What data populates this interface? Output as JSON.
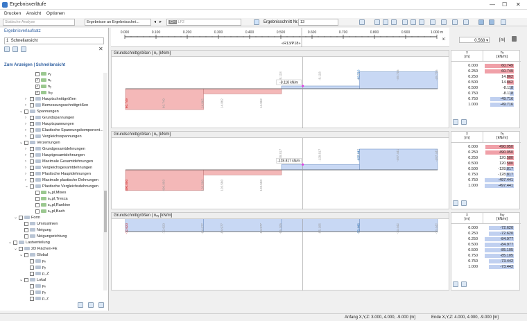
{
  "window": {
    "title": "Ergebnisverläufe"
  },
  "menu": [
    "Drucken",
    "Ansicht",
    "Optionen"
  ],
  "toolbar": {
    "analysis": "Statische Analyse",
    "results": "Ergebnisse an Ergebnisschni...",
    "load_prefix": "CH",
    "load_value": "LF2",
    "section_label": "Ergebnisschnitt Nr.",
    "section_value": "13"
  },
  "ruler": {
    "ticks": [
      "0.000",
      "0.100",
      "0.200",
      "0.300",
      "0.400",
      "0.500",
      "0.600",
      "0.700",
      "0.800",
      "0.900",
      "1.000 m"
    ],
    "unit": "x",
    "section": "«R13/P18»",
    "pos_value": "0.568",
    "pos_unit": "[m]",
    "pos_label": "x:"
  },
  "left": {
    "label": "Ergebnisverlaufsatz",
    "preset_num": "1",
    "preset_name": "Schnellansicht",
    "section": "Zum Anzeigen | Schnellansicht",
    "tree": [
      {
        "t": "vᵧ",
        "lvl": 3,
        "cb": "o"
      },
      {
        "t": "nₓ",
        "lvl": 3,
        "cb": "x"
      },
      {
        "t": "nᵧ",
        "lvl": 3,
        "cb": "x"
      },
      {
        "t": "nₓᵧ",
        "lvl": 3,
        "cb": "x"
      },
      {
        "t": "Hauptschnittgrößen",
        "lvl": 2,
        "cb": "o",
        "exp": "›"
      },
      {
        "t": "Bemessungsschnittgrößen",
        "lvl": 2,
        "cb": "o",
        "exp": "›"
      },
      {
        "t": "Spannungen",
        "lvl": 1,
        "cb": "o",
        "exp": "⌄"
      },
      {
        "t": "Grundspannungen",
        "lvl": 2,
        "cb": "o",
        "exp": "›"
      },
      {
        "t": "Hauptspannungen",
        "lvl": 2,
        "cb": "o",
        "exp": "›"
      },
      {
        "t": "Elastische Spannungskomponent...",
        "lvl": 2,
        "cb": "o",
        "exp": "›"
      },
      {
        "t": "Vergleichsspannungen",
        "lvl": 2,
        "cb": "o",
        "exp": "›"
      },
      {
        "t": "Verzerrungen",
        "lvl": 1,
        "cb": "o",
        "exp": "⌄"
      },
      {
        "t": "Grundgesamtdehnungen",
        "lvl": 2,
        "cb": "o",
        "exp": "›"
      },
      {
        "t": "Hauptgesamtdehnungen",
        "lvl": 2,
        "cb": "o",
        "exp": "›"
      },
      {
        "t": "Maximale Gesamtdehnungen",
        "lvl": 2,
        "cb": "o",
        "exp": "›"
      },
      {
        "t": "Vergleichsgesamtdehnungen",
        "lvl": 2,
        "cb": "o",
        "exp": "›"
      },
      {
        "t": "Plastische Hauptdehnungen",
        "lvl": 2,
        "cb": "o",
        "exp": "›"
      },
      {
        "t": "Maximale plastische Dehnungen",
        "lvl": 2,
        "cb": "o",
        "exp": "›"
      },
      {
        "t": "Plastische Vergleichsdehnungen",
        "lvl": 2,
        "cb": "o",
        "exp": "⌄"
      },
      {
        "t": "εᵥ,pl,Mises",
        "lvl": 3,
        "cb": "o"
      },
      {
        "t": "εᵥ,pl,Tresca",
        "lvl": 3,
        "cb": "o"
      },
      {
        "t": "εᵥ,pl,Rankine",
        "lvl": 3,
        "cb": "o"
      },
      {
        "t": "εᵥ,pl,Bach",
        "lvl": 3,
        "cb": "o"
      },
      {
        "t": "Form",
        "lvl": 0,
        "cb": "o",
        "exp": "⌄"
      },
      {
        "t": "Umrisslinien",
        "lvl": 1,
        "cb": "o"
      },
      {
        "t": "Neigung",
        "lvl": 1,
        "cb": "o"
      },
      {
        "t": "Neigungsrichtung",
        "lvl": 1,
        "cb": "o"
      },
      {
        "t": "Lastverteilung",
        "lvl": -1,
        "cb": "o",
        "exp": "⌄"
      },
      {
        "t": "2D Flächen-FE",
        "lvl": 0,
        "cb": "o",
        "exp": "⌄"
      },
      {
        "t": "Global",
        "lvl": 1,
        "cb": "o",
        "exp": "⌄"
      },
      {
        "t": "pₓ",
        "lvl": 2,
        "cb": "o"
      },
      {
        "t": "pᵧ",
        "lvl": 2,
        "cb": "o"
      },
      {
        "t": "p_Z",
        "lvl": 2,
        "cb": "o"
      },
      {
        "t": "Lokal",
        "lvl": 1,
        "cb": "o",
        "exp": "⌄"
      },
      {
        "t": "pₓ",
        "lvl": 2,
        "cb": "o"
      },
      {
        "t": "pᵧ",
        "lvl": 2,
        "cb": "o"
      },
      {
        "t": "p_z",
        "lvl": 2,
        "cb": "o"
      }
    ]
  },
  "plots": [
    {
      "title": "Grundschnittgrößen | nₓ [kN/m]",
      "cursor": "-8.118 kN/m",
      "left_label": "60.749",
      "labels": [
        "60.749",
        "60.749",
        "14.862",
        "14.862",
        "14.862",
        "-8.118",
        "-8.118",
        "-8.118",
        "-49.716",
        "-49.716",
        "-49.716"
      ]
    },
    {
      "title": "Grundschnittgrößen | nᵧ [kN/m]",
      "cursor": "-128.817 kN/m",
      "left_label": "490.050",
      "labels": [
        "490.050",
        "490.050",
        "120.580",
        "120.580",
        "120.580",
        "-128.817",
        "-128.817",
        "-128.817",
        "-497.441",
        "-497.441",
        "-497.441"
      ]
    },
    {
      "title": "Grundschnittgrößen | nₓᵧ [kN/m]",
      "cursor": "-85.105 kN/m",
      "left_label": "-72.620",
      "labels": [
        "-72.620",
        "-72.620",
        "-84.977",
        "-84.977",
        "-84.977",
        "-85.105",
        "-85.105",
        "-85.105",
        "-73.442",
        "-73.442",
        "-73.442"
      ]
    }
  ],
  "tables": [
    {
      "h1": "x",
      "h1u": "[m]",
      "h2": "nₓ",
      "h2u": "[kN/m]",
      "rows": [
        [
          "0.000",
          "60.749"
        ],
        [
          "0.250",
          "60.749"
        ],
        [
          "0.250",
          "14.862"
        ],
        [
          "0.500",
          "14.862"
        ],
        [
          "0.500",
          "-8.118"
        ],
        [
          "0.750",
          "-8.118"
        ],
        [
          "0.750",
          "-49.716"
        ],
        [
          "1.000",
          "-49.716"
        ]
      ]
    },
    {
      "h1": "x",
      "h1u": "[m]",
      "h2": "nᵧ",
      "h2u": "[kN/m]",
      "rows": [
        [
          "0.000",
          "490.050"
        ],
        [
          "0.250",
          "490.050"
        ],
        [
          "0.250",
          "120.580"
        ],
        [
          "0.500",
          "120.580"
        ],
        [
          "0.500",
          "-128.817"
        ],
        [
          "0.750",
          "-128.817"
        ],
        [
          "0.750",
          "-497.441"
        ],
        [
          "1.000",
          "-497.441"
        ]
      ]
    },
    {
      "h1": "x",
      "h1u": "[m]",
      "h2": "nₓᵧ",
      "h2u": "[kN/m]",
      "rows": [
        [
          "0.000",
          "-72.620"
        ],
        [
          "0.250",
          "-72.620"
        ],
        [
          "0.250",
          "-84.977"
        ],
        [
          "0.500",
          "-84.977"
        ],
        [
          "0.500",
          "-85.105"
        ],
        [
          "0.750",
          "-85.105"
        ],
        [
          "0.750",
          "-73.442"
        ],
        [
          "1.000",
          "-73.442"
        ]
      ]
    }
  ],
  "status": {
    "start": "Anfang X,Y,Z: 3.000, 4.000, -9.000 [m]",
    "end": "Ende X,Y,Z: 4.000, 4.000, -9.000 [m]"
  },
  "colors": {
    "pos": "#f4b8b8",
    "neg": "#c8d8f4",
    "accent": "#e040e0",
    "label_blue": "#2f7fd0",
    "label_red": "#d02020"
  }
}
